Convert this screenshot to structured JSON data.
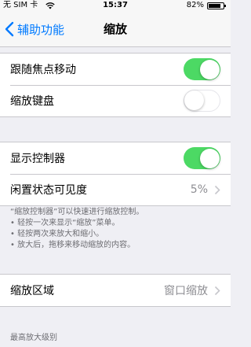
{
  "status_bar": {
    "carrier": "无 SIM 卡",
    "time": "15:37",
    "battery_percent": "82%",
    "battery_level": 0.82
  },
  "nav": {
    "back_label": "辅助功能",
    "title": "缩放"
  },
  "group1": {
    "follow_focus": {
      "label": "跟随焦点移动",
      "on": true
    },
    "zoom_keyboard": {
      "label": "缩放键盘",
      "on": false
    }
  },
  "group2": {
    "show_controller": {
      "label": "显示控制器",
      "on": true
    },
    "idle_visibility": {
      "label": "闲置状态可见度",
      "value": "5%"
    }
  },
  "footnote": {
    "lines": [
      "“缩放控制器”可以快速进行缩放控制。",
      "• 轻按一次来显示“缩放”菜单。",
      "• 轻按两次来放大和缩小。",
      "• 放大后，拖移来移动缩放的内容。"
    ]
  },
  "group3": {
    "zoom_region": {
      "label": "缩放区域",
      "value": "窗口缩放"
    }
  },
  "max_zoom_header": "最高放大级别",
  "colors": {
    "accent": "#007aff",
    "switch_on": "#4cd964",
    "background": "#efeff4"
  }
}
